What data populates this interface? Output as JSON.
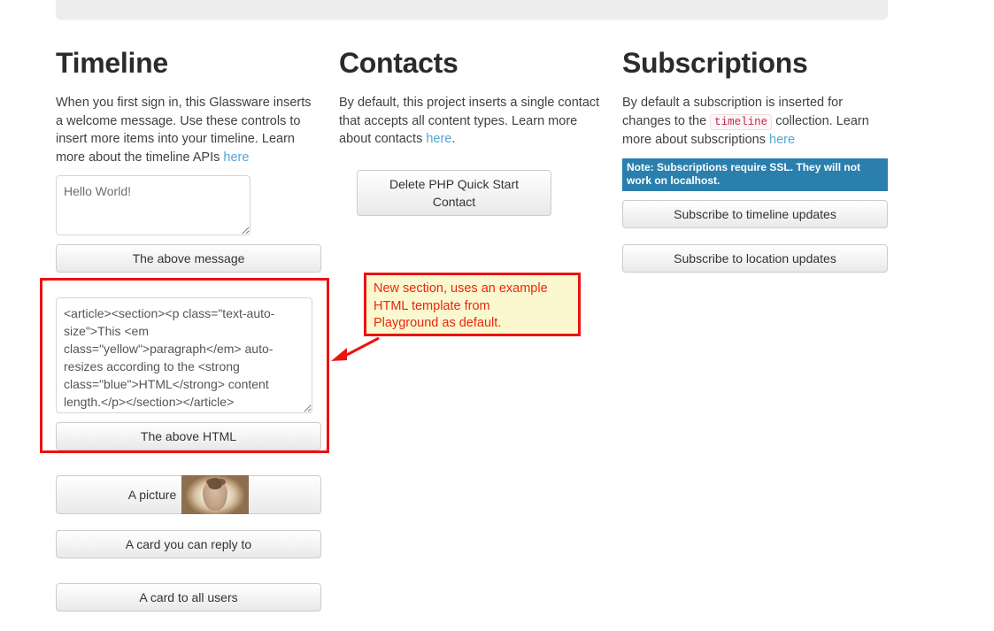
{
  "page": {
    "topbar_present": true
  },
  "columns": {
    "timeline": {
      "title": "Timeline",
      "desc_before_link": "When you first sign in, this Glassware inserts a welcome message. Use these controls to insert more items into your timeline. Learn more about the timeline APIs ",
      "desc_link": "here",
      "message_textarea_value": "Hello World!",
      "message_button": "The above message",
      "html_textarea_value": "<article><section><p class=\"text-auto-size\">This <em class=\"yellow\">paragraph</em> auto-resizes according to the <strong class=\"blue\">HTML</strong> content length.</p></section></article>",
      "html_button": "The above HTML",
      "picture_button": "A picture",
      "reply_card_button": "A card you can reply to",
      "all_users_card_button": "A card to all users"
    },
    "contacts": {
      "title": "Contacts",
      "desc_before_link": "By default, this project inserts a single contact that accepts all content types. Learn more about contacts ",
      "desc_link": "here",
      "desc_after_link": ".",
      "delete_button": "Delete PHP Quick Start Contact"
    },
    "subscriptions": {
      "title": "Subscriptions",
      "desc_part1": "By default a subscription is inserted for changes to the ",
      "desc_code": "timeline",
      "desc_part2": " collection. Learn more about subscriptions ",
      "desc_link": "here",
      "note_badge": "Note: Subscriptions require SSL.\nThey will not work on localhost.",
      "subscribe_timeline_button": "Subscribe to timeline updates",
      "subscribe_location_button": "Subscribe to location updates"
    }
  },
  "annotations": {
    "callout_text": "New section, uses an example\nHTML template from\nPlayground as default.",
    "highlight_color": "#ee1111",
    "callout_bg": "#fbf8cf",
    "callout_text_color": "#e8270f"
  },
  "colors": {
    "link": "#51a7d8",
    "note_badge_bg": "#2a7fad",
    "code_text": "#c7254e",
    "heading": "#2b2b2b",
    "topbar_bg": "#ededed"
  }
}
